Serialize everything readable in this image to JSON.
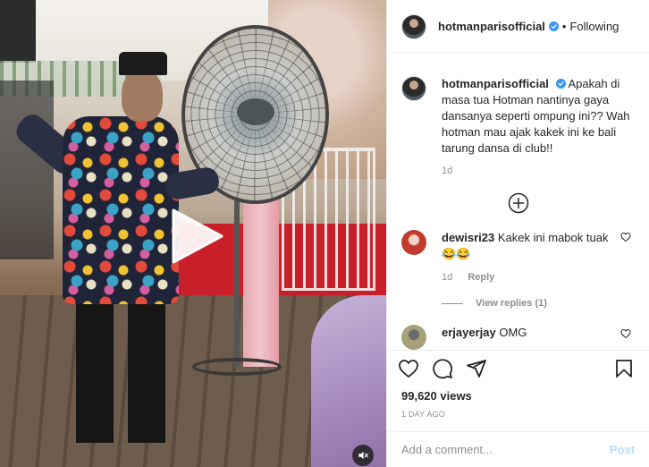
{
  "post": {
    "username": "hotmanparisofficial",
    "follow_status": "Following",
    "separator": "•"
  },
  "caption": {
    "username": "hotmanparisofficial",
    "text": "Apakah di masa tua Hotman nantinya gaya dansanya seperti ompung ini?? Wah hotman mau ajak kakek ini ke bali tarung dansa di club!!",
    "time": "1d"
  },
  "comments": [
    {
      "username": "dewisri23",
      "text": "Kakek ini mabok tuak",
      "emoji": "😂😂",
      "time": "1d",
      "reply_label": "Reply",
      "view_replies": "View replies (1)"
    },
    {
      "username": "erjayerjay",
      "text": "OMG"
    }
  ],
  "stats": {
    "views": "99,620 views",
    "posted": "1 DAY AGO"
  },
  "add_comment": {
    "placeholder": "Add a comment...",
    "post_label": "Post"
  },
  "icons": {
    "play": "play-icon",
    "mute": "mute-icon",
    "verified": "verified-badge-icon",
    "load_more": "plus-circle-icon",
    "like": "heart-icon",
    "comment": "comment-bubble-icon",
    "save": "bookmark-icon"
  },
  "colors": {
    "verified": "#3897f0",
    "post_button": "#b2dffc",
    "muted_text": "#8e8e8e"
  }
}
